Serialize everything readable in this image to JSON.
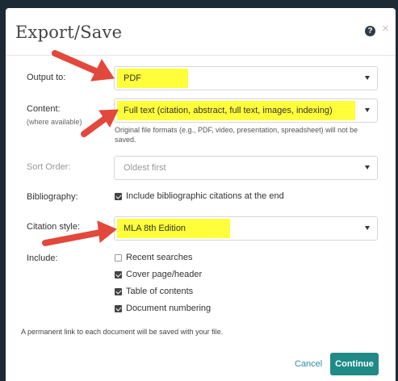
{
  "dialog": {
    "title": "Export/Save",
    "help_icon": "?",
    "close_icon": "×"
  },
  "fields": {
    "output_to": {
      "label": "Output to:",
      "value": "PDF"
    },
    "content": {
      "label": "Content:",
      "sublabel": "(where available)",
      "value": "Full text (citation, abstract, full text, images, indexing)",
      "note": "Original file formats (e.g., PDF, video, presentation, spreadsheet) will not be saved."
    },
    "sort_order": {
      "label": "Sort Order:",
      "value": "Oldest first"
    },
    "bibliography": {
      "label": "Bibliography:",
      "option": "Include bibliographic citations at the end",
      "checked": true
    },
    "citation_style": {
      "label": "Citation style:",
      "value": "MLA 8th Edition"
    },
    "include": {
      "label": "Include:",
      "options": [
        {
          "label": "Recent searches",
          "checked": false
        },
        {
          "label": "Cover page/header",
          "checked": true
        },
        {
          "label": "Table of contents",
          "checked": true
        },
        {
          "label": "Document numbering",
          "checked": true
        }
      ]
    }
  },
  "footnote": "A permanent link to each document will be saved with your file.",
  "buttons": {
    "cancel": "Cancel",
    "continue": "Continue"
  },
  "colors": {
    "highlight": "#fefe3a",
    "arrow": "#e2483b",
    "primary": "#1f8a86",
    "link": "#2b8fa8"
  }
}
